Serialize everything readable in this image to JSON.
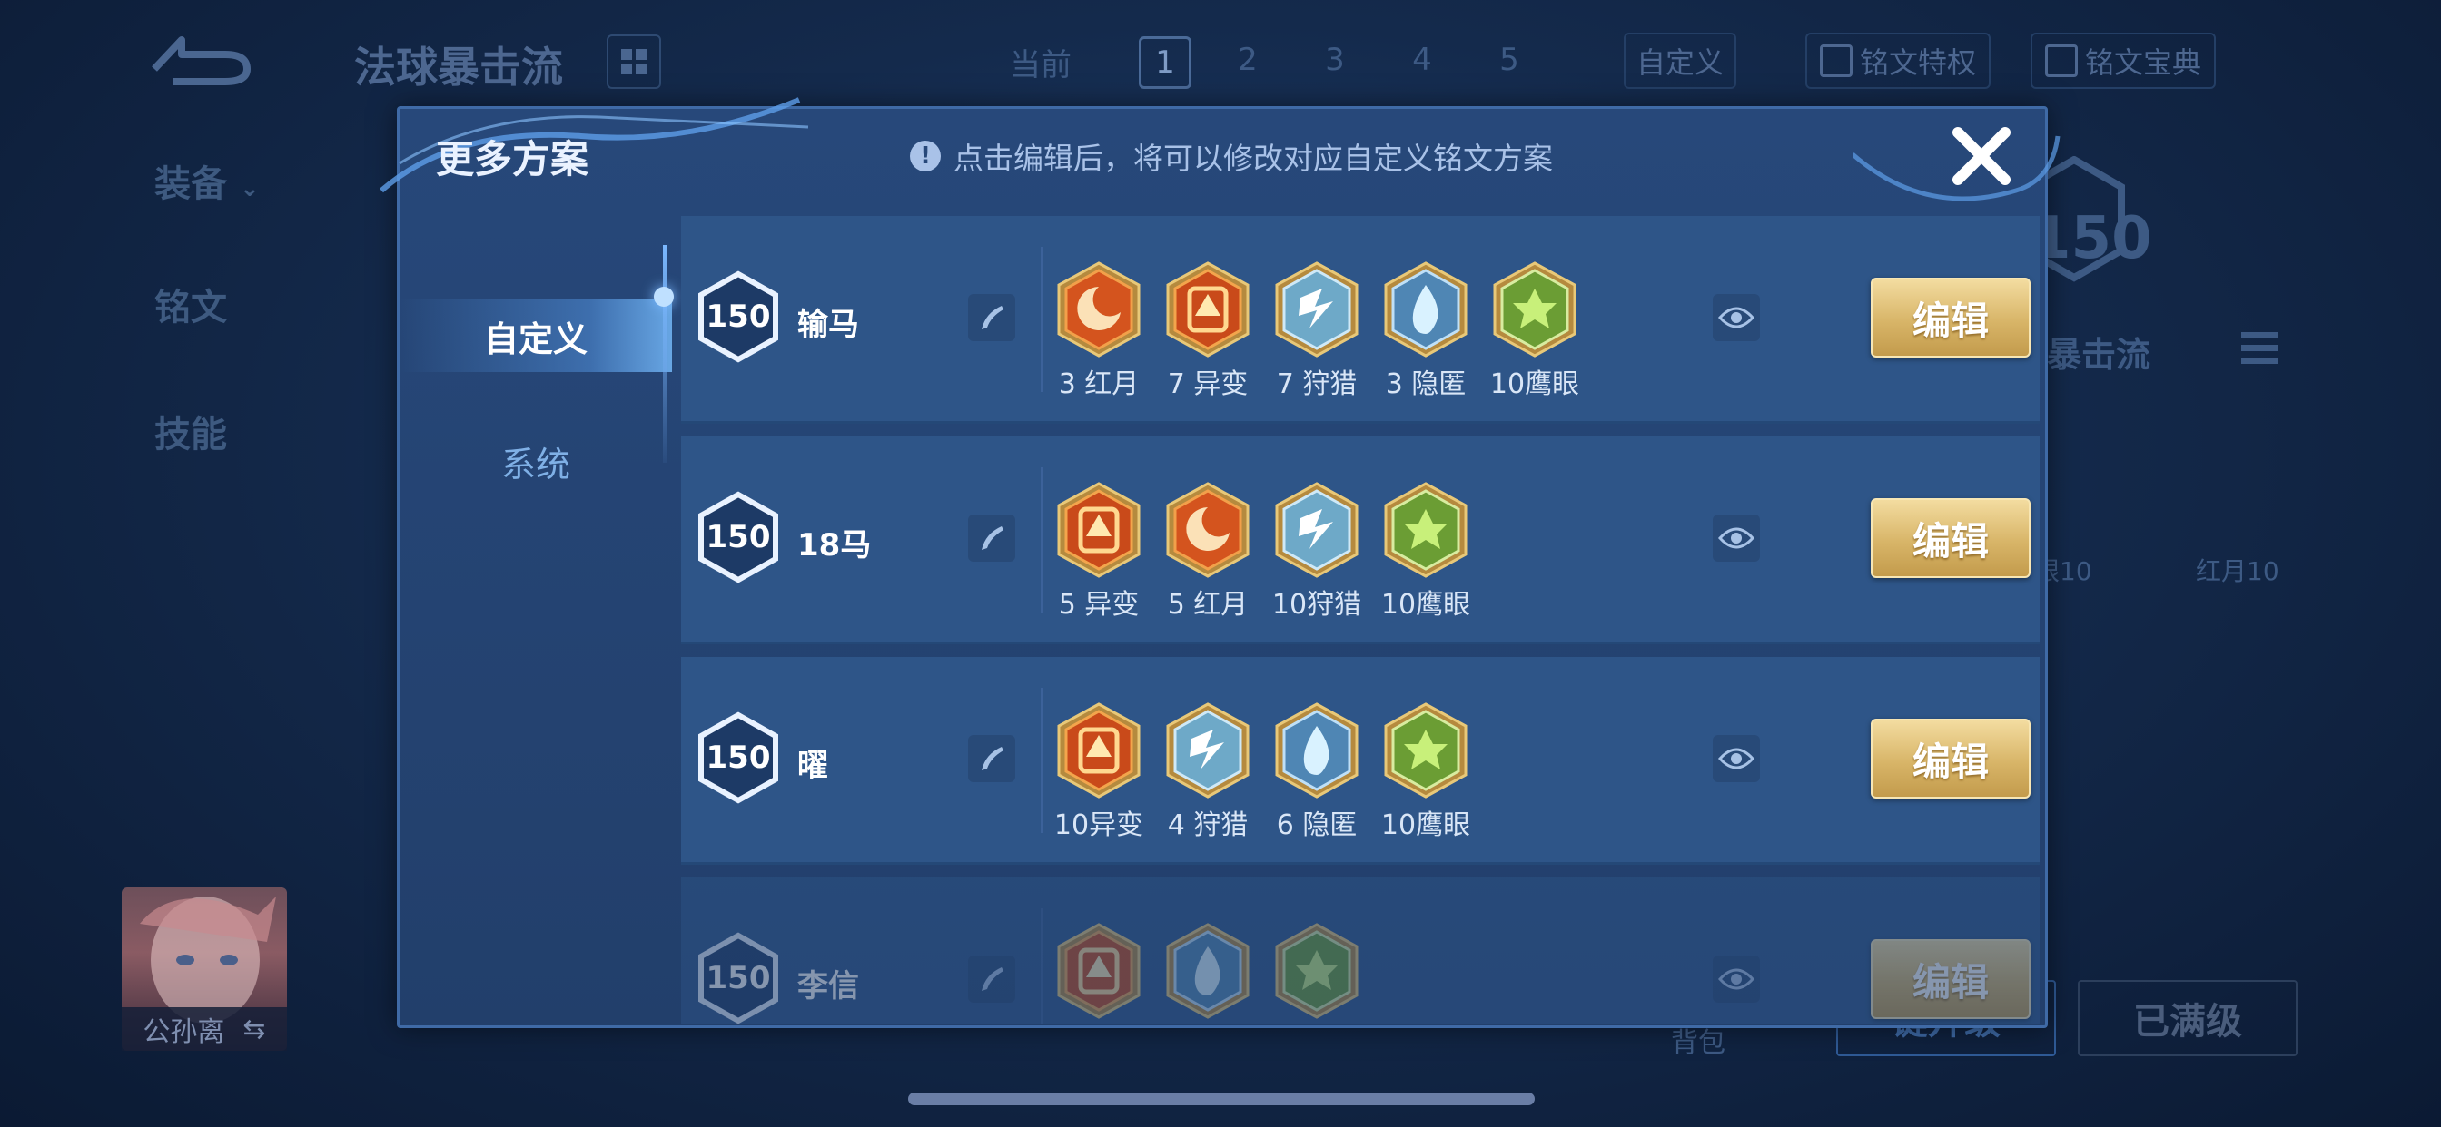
{
  "background": {
    "page_title": "法球暴击流",
    "current_label": "当前",
    "page_tabs": [
      "1",
      "2",
      "3",
      "4",
      "5"
    ],
    "active_page": "1",
    "custom_label": "自定义",
    "privilege_label": "铭文特权",
    "treasure_label": "铭文宝典",
    "side_nav": [
      "装备",
      "铭文",
      "技能"
    ],
    "hero_name": "公孙离",
    "right_level": "150",
    "right_scheme": "暴击流",
    "right_rune_labels": [
      "眼10",
      "红月10"
    ],
    "backpack_label": "背包",
    "upgrade_label": "键升级",
    "maxed_label": "已满级"
  },
  "modal": {
    "title": "更多方案",
    "hint": "点击编辑后，将可以修改对应自定义铭文方案",
    "categories": [
      {
        "label": "自定义",
        "active": true
      },
      {
        "label": "系统",
        "active": false
      }
    ],
    "edit_label": "编辑",
    "rows": [
      {
        "level": "150",
        "name": "输马",
        "runes": [
          {
            "type": "red-moon",
            "label": "3 红月"
          },
          {
            "type": "mutation",
            "label": "7 异变"
          },
          {
            "type": "hunt",
            "label": "7 狩猎"
          },
          {
            "type": "conceal",
            "label": "3 隐匿"
          },
          {
            "type": "hawk-eye",
            "label": "10鹰眼"
          }
        ]
      },
      {
        "level": "150",
        "name": "18马",
        "runes": [
          {
            "type": "mutation",
            "label": "5 异变"
          },
          {
            "type": "red-moon",
            "label": "5 红月"
          },
          {
            "type": "hunt",
            "label": "10狩猎"
          },
          {
            "type": "hawk-eye",
            "label": "10鹰眼"
          }
        ]
      },
      {
        "level": "150",
        "name": "曜",
        "runes": [
          {
            "type": "mutation",
            "label": "10异变"
          },
          {
            "type": "hunt",
            "label": "4 狩猎"
          },
          {
            "type": "conceal",
            "label": "6 隐匿"
          },
          {
            "type": "hawk-eye",
            "label": "10鹰眼"
          }
        ]
      },
      {
        "level": "150",
        "name": "李信",
        "runes": [
          {
            "type": "mutation",
            "label": ""
          },
          {
            "type": "conceal",
            "label": ""
          },
          {
            "type": "hawk-eye",
            "label": ""
          }
        ]
      }
    ]
  },
  "icons": {
    "back": "back-arrow-icon",
    "grid": "grid-icon",
    "close": "close-icon",
    "edit": "pencil-icon",
    "eye": "eye-icon",
    "info": "info-icon"
  },
  "colors": {
    "accent_gold": "#d8b568",
    "modal_bg": "#27487a",
    "row_bg": "#2e5588"
  }
}
